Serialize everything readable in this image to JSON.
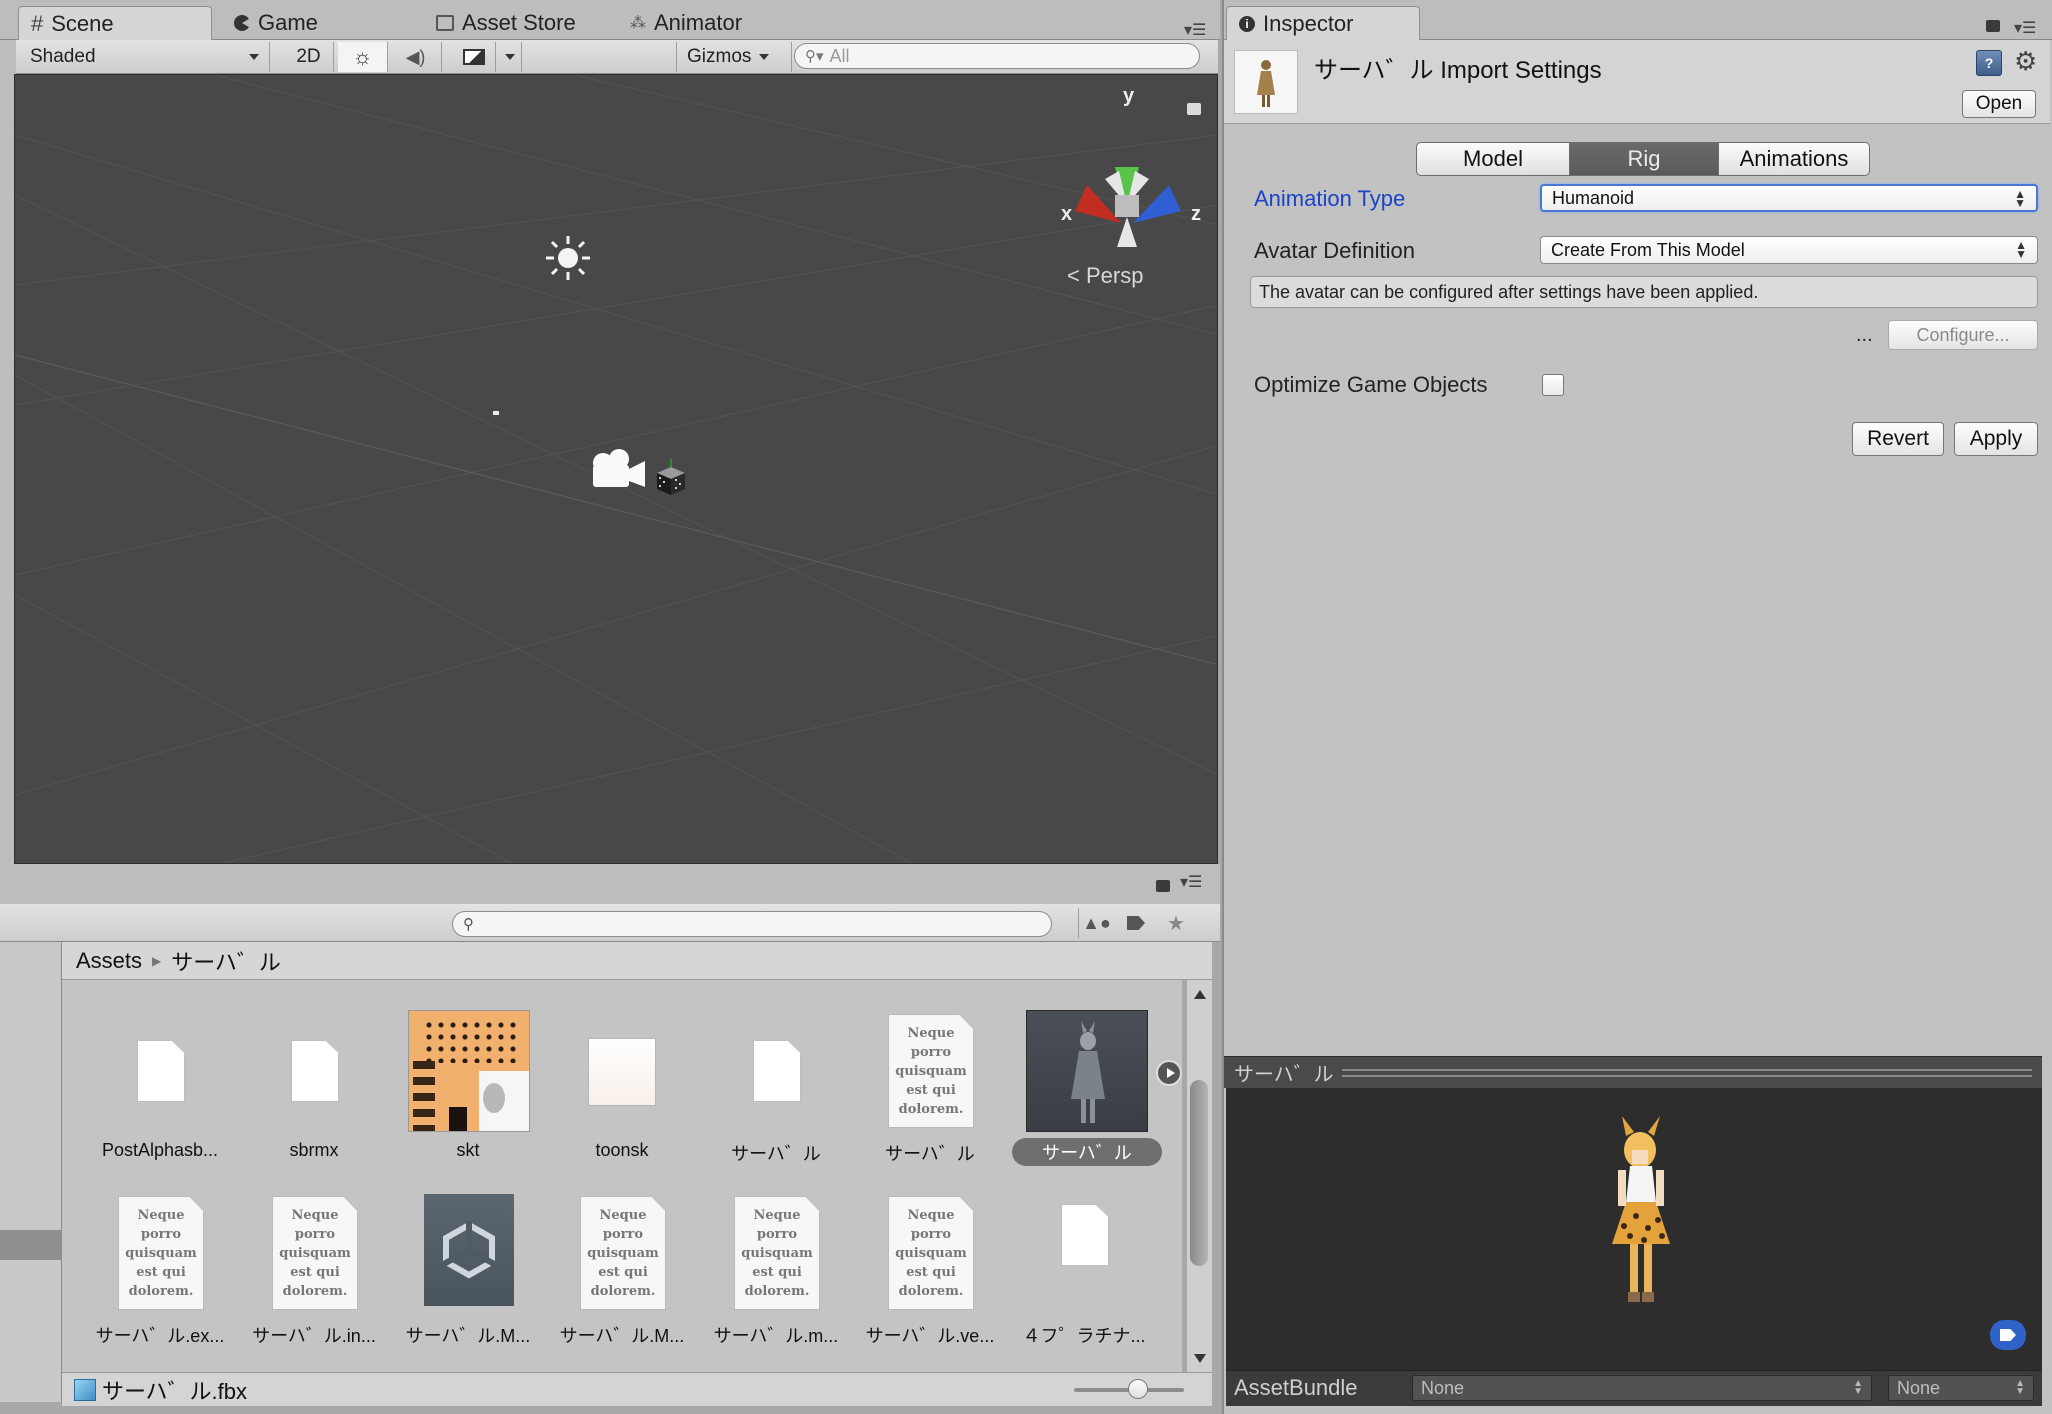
{
  "scene_tabs": [
    {
      "label": "Scene",
      "icon": "grid-icon"
    },
    {
      "label": "Game",
      "icon": "pacman-icon"
    },
    {
      "label": "Asset Store",
      "icon": "store-icon"
    },
    {
      "label": "Animator",
      "icon": "animator-icon"
    }
  ],
  "scene_toolbar": {
    "shading": "Shaded",
    "mode_2d": "2D",
    "gizmos": "Gizmos",
    "search_placeholder": "All"
  },
  "viewport": {
    "axis_y": "y",
    "axis_x": "x",
    "axis_z": "z",
    "projection": "Persp"
  },
  "inspector": {
    "tab": "Inspector",
    "title": "サーハ゛ル Import Settings",
    "open_button": "Open",
    "tabs": [
      "Model",
      "Rig",
      "Animations"
    ],
    "active_tab": "Rig",
    "animation_type_label": "Animation Type",
    "animation_type_value": "Humanoid",
    "avatar_definition_label": "Avatar Definition",
    "avatar_definition_value": "Create From This Model",
    "info_text": "The avatar can be configured after settings have been applied.",
    "ellipsis": "...",
    "configure_button": "Configure...",
    "optimize_label": "Optimize Game Objects",
    "optimize_checked": false,
    "revert_button": "Revert",
    "apply_button": "Apply",
    "accent_color": "#1a44c8"
  },
  "preview": {
    "title": "サーハ゛ル",
    "assetbundle_label": "AssetBundle",
    "assetbundle_value": "None",
    "variant_value": "None"
  },
  "project": {
    "breadcrumb_root": "Assets",
    "breadcrumb_folder": "サーハ゛ル",
    "doc_text": "Neque porro quisquam est qui dolorem.",
    "assets_row1": [
      {
        "label": "PostAlphasb...",
        "kind": "doc"
      },
      {
        "label": "sbrmx",
        "kind": "doc"
      },
      {
        "label": "skt",
        "kind": "texture"
      },
      {
        "label": "toonsk",
        "kind": "blank-texture"
      },
      {
        "label": "サーハ゛ル",
        "kind": "doc"
      },
      {
        "label": "サーハ゛ル",
        "kind": "text"
      },
      {
        "label": "サーハ゛ル",
        "kind": "model",
        "selected": true
      }
    ],
    "assets_row2": [
      {
        "label": "サーハ゛ル.ex...",
        "kind": "text"
      },
      {
        "label": "サーハ゛ル.in...",
        "kind": "text"
      },
      {
        "label": "サーハ゛ル.M...",
        "kind": "unity"
      },
      {
        "label": "サーハ゛ル.M...",
        "kind": "text"
      },
      {
        "label": "サーハ゛ル.m...",
        "kind": "text"
      },
      {
        "label": "サーハ゛ル.ve...",
        "kind": "text"
      },
      {
        "label": "４フ゜ラチナ...",
        "kind": "doc"
      }
    ],
    "status_file": "サーハ゛ル.fbx"
  }
}
